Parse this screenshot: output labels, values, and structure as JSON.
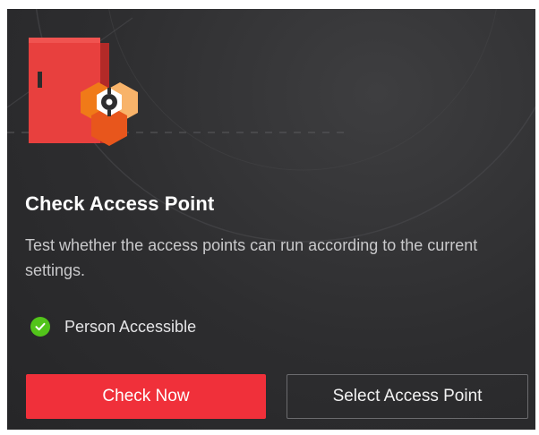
{
  "card": {
    "title": "Check Access Point",
    "description": "Test whether the access points can run according to the current settings.",
    "status": {
      "text": "Person Accessible",
      "icon": "check-circle-icon",
      "color": "#52c41a"
    },
    "buttons": {
      "primary_label": "Check Now",
      "secondary_label": "Select Access Point"
    }
  },
  "colors": {
    "accent": "#f0303a",
    "door": "#e8403e",
    "hex_orange": "#f07a18",
    "hex_light": "#f8b36a"
  }
}
